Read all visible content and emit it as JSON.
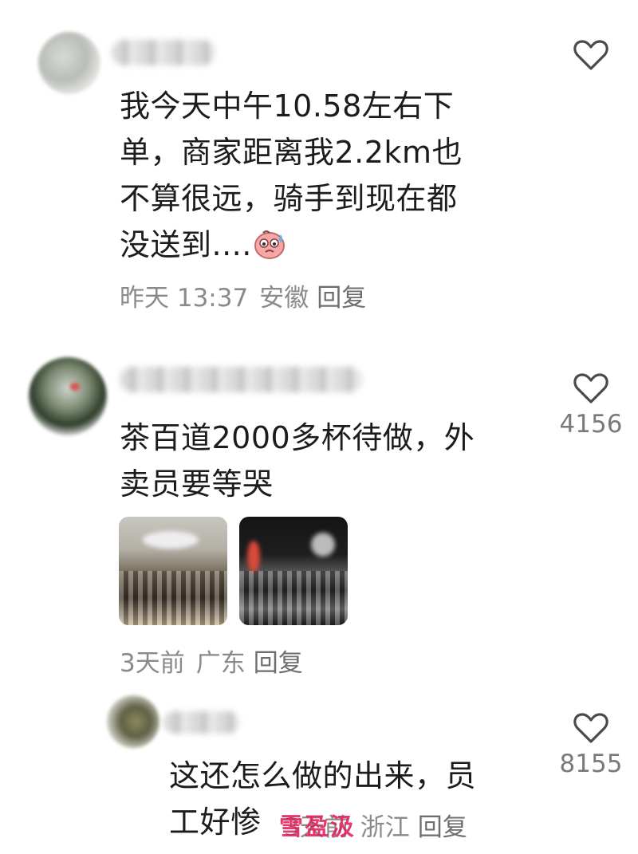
{
  "comments": [
    {
      "text_lines": [
        "我今天中午10.58左右下",
        "单，商家距离我2.2km也",
        "不算很远，骑手到现在都",
        "没送到...."
      ],
      "emoji": "sweating-face-emoji",
      "date": "昨天 13:37",
      "location": "安徽",
      "reply_label": "回复",
      "like_count": ""
    },
    {
      "text_lines": [
        "茶百道2000多杯待做，外",
        "卖员要等哭"
      ],
      "date": "3天前",
      "location": "广东",
      "reply_label": "回复",
      "like_count": "4156"
    },
    {
      "text_lines": [
        "这还怎么做的出来，员",
        "工好惨"
      ],
      "date": "3天前",
      "location": "浙江",
      "reply_label": "回复",
      "like_count": "8155"
    }
  ],
  "watermark": "雪盈汲",
  "icons": {
    "like": "heart-outline-icon",
    "emoji": "sweating-face-emoji"
  },
  "colors": {
    "text": "#1c1c1c",
    "meta": "#8a8a8a",
    "watermark": "#e0245e"
  }
}
